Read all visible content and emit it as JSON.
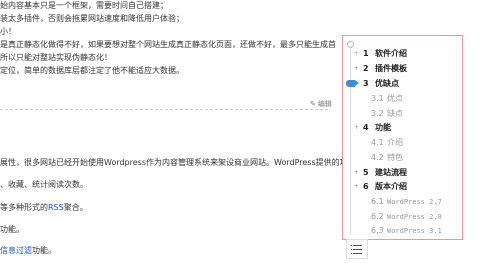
{
  "article": {
    "lines": [
      "始内容基本只是一个框架，需要时间自己搭建；",
      "装太多插件，否则会拖累网站速度和降低用户体验；",
      "小！",
      "是真正静态化做得不好，如果要想对整个网站生成真正静态化页面，还做不好，最多只能生成首",
      "所以只能对整站实现伪静态化！",
      "定位，简单的数据库层都注定了他不能适应大数据。"
    ],
    "edit_label": "编辑",
    "lower_lines": [
      "展性，很多网站已经开始使用Wordpress作为内容管理系统来架设商业网站。WordPress提供的功",
      "、收藏、统计阅读次数。",
      "等多种形式的",
      "RSS",
      "聚合。",
      "功能。",
      "信息过滤",
      "功能。"
    ]
  },
  "toc": {
    "items": [
      {
        "num": "1",
        "label": "软件介绍"
      },
      {
        "num": "2",
        "label": "插件模板"
      },
      {
        "num": "3",
        "label": "优缺点"
      },
      {
        "num": "3.1",
        "label": "优点"
      },
      {
        "num": "3.2",
        "label": "缺点"
      },
      {
        "num": "4",
        "label": "功能"
      },
      {
        "num": "4.1",
        "label": "介绍"
      },
      {
        "num": "4.2",
        "label": "特色"
      },
      {
        "num": "5",
        "label": "建站流程"
      },
      {
        "num": "6",
        "label": "版本介绍"
      },
      {
        "num": "6.1",
        "label": "WordPress 2.7"
      },
      {
        "num": "6.2",
        "label": "WordPress 2.8"
      },
      {
        "num": "6.3",
        "label": "WordPress 3.1"
      }
    ],
    "plus_symbol": "+",
    "active_color": "#3e8ed8",
    "border_color": "#e59aa0",
    "toggle_icon": "list-icon"
  }
}
